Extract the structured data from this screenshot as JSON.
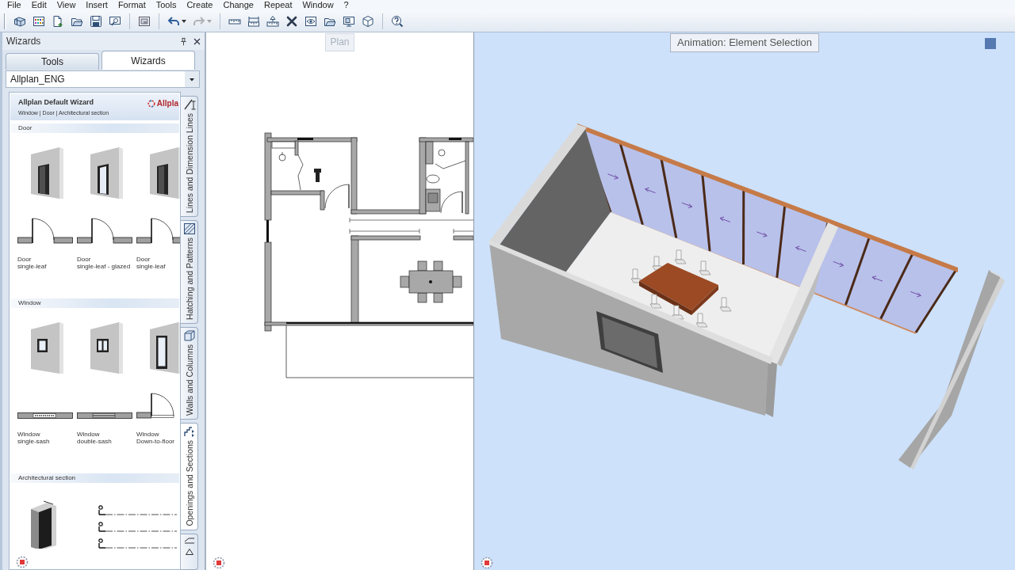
{
  "menu": [
    "File",
    "Edit",
    "View",
    "Insert",
    "Format",
    "Tools",
    "Create",
    "Change",
    "Repeat",
    "Window",
    "?"
  ],
  "toolbar": [
    {
      "buttons": [
        {
          "kind": "blocks",
          "disabled": false
        },
        {
          "kind": "grid",
          "disabled": false
        },
        {
          "kind": "new",
          "disabled": false
        },
        {
          "kind": "open",
          "disabled": false
        },
        {
          "kind": "save",
          "disabled": false
        },
        {
          "kind": "preview",
          "disabled": false
        }
      ]
    },
    {
      "buttons": [
        {
          "kind": "picture",
          "disabled": false
        }
      ]
    },
    {
      "buttons": [
        {
          "kind": "undo",
          "disabled": false
        },
        {
          "kind": "redo",
          "disabled": true
        }
      ]
    },
    {
      "buttons": [
        {
          "kind": "ruler",
          "disabled": false
        },
        {
          "kind": "dimension",
          "disabled": false
        },
        {
          "kind": "elevation",
          "disabled": false
        },
        {
          "kind": "tools",
          "disabled": false
        },
        {
          "kind": "eye",
          "disabled": false
        },
        {
          "kind": "folder",
          "disabled": false
        },
        {
          "kind": "screen",
          "disabled": false
        },
        {
          "kind": "cube",
          "disabled": false
        }
      ]
    },
    {
      "buttons": [
        {
          "kind": "help",
          "disabled": false
        }
      ]
    }
  ],
  "panel": {
    "title": "Wizards",
    "tabs": [
      {
        "label": "Tools",
        "selected": false
      },
      {
        "label": "Wizards",
        "selected": true
      }
    ],
    "dropdown": {
      "value": "Allplan_ENG"
    },
    "wizard": {
      "title": "Allplan Default Wizard",
      "subtitle": "Window | Door | Architectural section",
      "logo": "Allpla",
      "sections": [
        {
          "title": "Door",
          "items": [
            {
              "kind": "door",
              "label": "Door",
              "sublabel": "single-leaf"
            },
            {
              "kind": "glazeddoor",
              "label": "Door",
              "sublabel": "single-leaf - glazed"
            },
            {
              "kind": "door",
              "label": "Door",
              "sublabel": "single-leaf"
            }
          ]
        },
        {
          "title": "Window",
          "items": [
            {
              "kind": "window",
              "label": "Window",
              "sublabel": "single-sash"
            },
            {
              "kind": "doublewindow",
              "label": "Window",
              "sublabel": "double-sash"
            },
            {
              "kind": "floorwindow",
              "label": "Window",
              "sublabel": "Down-to-floor"
            }
          ]
        },
        {
          "title": "Architectural section",
          "items": [
            {
              "kind": "column"
            },
            {
              "kind": "axes"
            }
          ]
        }
      ]
    },
    "side_tabs": [
      {
        "kind": "dimension",
        "label": "Lines and Dimension Lines",
        "selected": false
      },
      {
        "kind": "hatching",
        "label": "Hatching and Patterns",
        "selected": false
      },
      {
        "kind": "walls",
        "label": "Walls and Columns",
        "selected": false
      },
      {
        "kind": "openings",
        "label": "Openings and Sections",
        "selected": true
      },
      {
        "kind": "leader",
        "selected": false
      }
    ]
  },
  "plan_view": {
    "label": "Plan"
  },
  "model_view": {
    "label": "Animation: Element Selection"
  }
}
